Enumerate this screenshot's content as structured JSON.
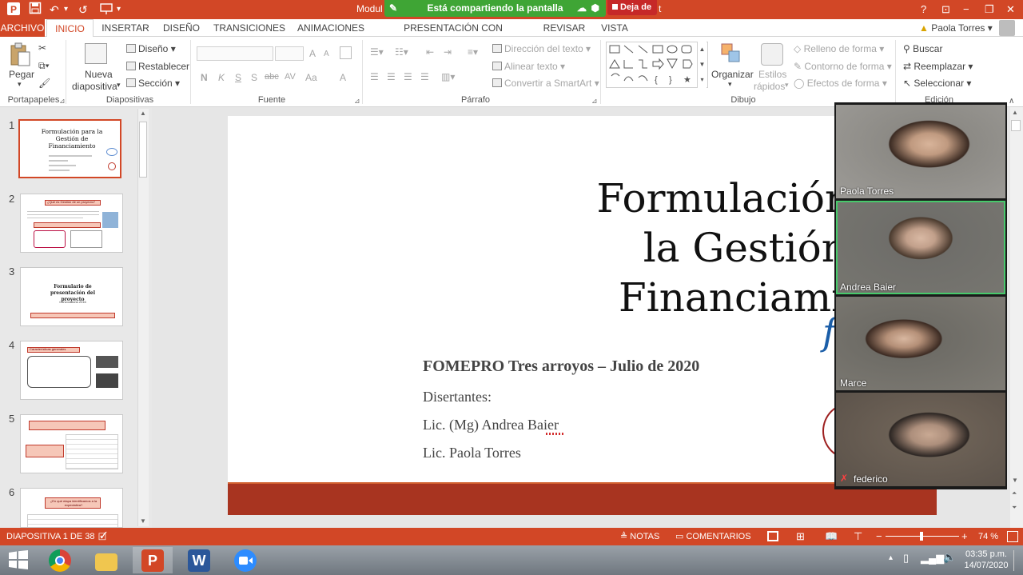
{
  "titlebar": {
    "title_left": "Modul",
    "title_right": "t",
    "share_banner": "Está compartiendo la pantalla",
    "stop_share": "Deja de",
    "help": "?",
    "minimize": "−",
    "restore": "❐",
    "close": "✕"
  },
  "tabs": [
    "ARCHIVO",
    "INICIO",
    "INSERTAR",
    "DISEÑO",
    "TRANSICIONES",
    "ANIMACIONES",
    "PRESENTACIÓN CON DIAPOSITIVAS",
    "REVISAR",
    "VISTA"
  ],
  "user": {
    "name": "Paola Torres"
  },
  "ribbon": {
    "portapapeles": {
      "pegar": "Pegar",
      "label": "Portapapeles"
    },
    "diapositivas": {
      "nueva": "Nueva",
      "diapositiva": "diapositiva",
      "diseno": "Diseño",
      "restablecer": "Restablecer",
      "seccion": "Sección",
      "label": "Diapositivas"
    },
    "fuente": {
      "label": "Fuente",
      "bold": "N",
      "italic": "K",
      "underline": "S",
      "shadow": "S",
      "strike": "abc",
      "spacing": "AV",
      "case": "Aa",
      "grow": "A",
      "shrink": "A",
      "color": "A"
    },
    "parrafo": {
      "direccion": "Dirección del texto",
      "alinear": "Alinear texto",
      "smartart": "Convertir a SmartArt",
      "label": "Párrafo"
    },
    "dibujo": {
      "organizar": "Organizar",
      "estilos": "Estilos",
      "rapidos": "rápidos",
      "relleno": "Relleno de forma",
      "contorno": "Contorno de forma",
      "efectos": "Efectos de forma",
      "label": "Dibujo"
    },
    "edicion": {
      "buscar": "Buscar",
      "reemplazar": "Reemplazar",
      "seleccionar": "Seleccionar",
      "label": "Edición"
    }
  },
  "thumbnails": [
    {
      "num": "1",
      "title": "Formulación para la Gestión de Financiamiento"
    },
    {
      "num": "2",
      "title": "¿Qué es Gestión de un proyecto?"
    },
    {
      "num": "3",
      "title": "Formulario de presentación del proyecto",
      "sub": "Convocatoria 2016"
    },
    {
      "num": "4",
      "title": "Características generales"
    },
    {
      "num": "5",
      "title": ""
    },
    {
      "num": "6",
      "title": "¿En qué etapa identificamos a la expectativa?"
    }
  ],
  "slide": {
    "title_line1": "Formulación para",
    "title_line2": "la Gestión de",
    "title_line3": "Financiamiento",
    "org_line": "FOMEPRO Tres arroyos – Julio de 2020",
    "disertantes": "Disertantes:",
    "speaker1": "Lic. (Mg) Andrea Baier",
    "speaker2": "Lic. Paola Torres"
  },
  "participants": [
    {
      "name": "Paola Torres"
    },
    {
      "name": "Andrea Baier"
    },
    {
      "name": "Marce"
    },
    {
      "name": "federico"
    }
  ],
  "statusbar": {
    "slide_indicator": "DIAPOSITIVA 1 DE 38",
    "notas": "NOTAS",
    "comentarios": "COMENTARIOS",
    "zoom": "74 %",
    "zoom_fraction": 0.49
  },
  "taskbar": {
    "time": "03:35 p.m.",
    "date": "14/07/2020"
  },
  "colors": {
    "accent": "#d24726",
    "share_green": "#3fa535",
    "slide_band": "#a83420"
  }
}
